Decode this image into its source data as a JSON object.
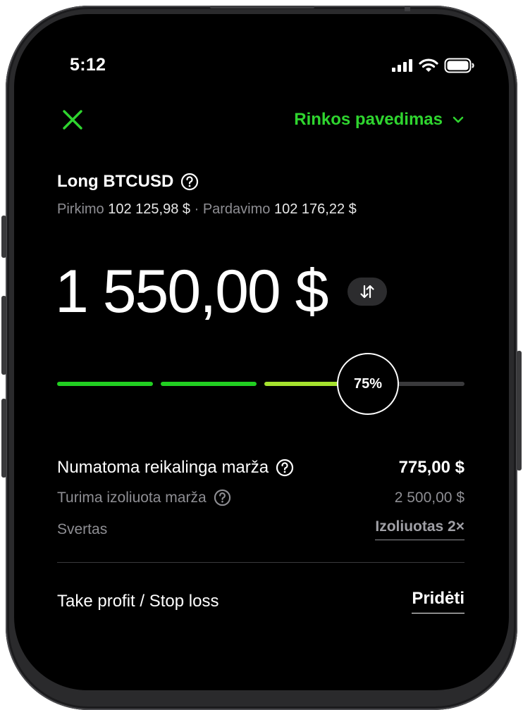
{
  "status_bar": {
    "time": "5:12"
  },
  "header": {
    "order_type_label": "Rinkos pavedimas"
  },
  "instrument": {
    "title": "Long BTCUSD",
    "buy_label": "Pirkimo",
    "buy_price": "102 125,98 $",
    "separator": "·",
    "sell_label": "Pardavimo",
    "sell_price": "102 176,22 $"
  },
  "amount": {
    "value": "1 550,00 $"
  },
  "slider": {
    "percent_label": "75%",
    "value_fraction": 0.75
  },
  "details": {
    "required_margin_label": "Numatoma reikalinga marža",
    "required_margin_value": "775,00 $",
    "available_margin_label": "Turima izoliuota marža",
    "available_margin_value": "2 500,00 $",
    "leverage_label": "Svertas",
    "leverage_value": "Izoliuotas 2×"
  },
  "tp_sl": {
    "label": "Take profit / Stop loss",
    "action_label": "Pridėti"
  },
  "colors": {
    "accent": "#2fd52f",
    "background": "#000000",
    "muted": "#8e8e93",
    "slider_light": "#a6e22e"
  },
  "icons": [
    "close-icon",
    "chevron-down-icon",
    "help-icon",
    "swap-icon",
    "signal-icon",
    "wifi-icon",
    "battery-icon"
  ]
}
